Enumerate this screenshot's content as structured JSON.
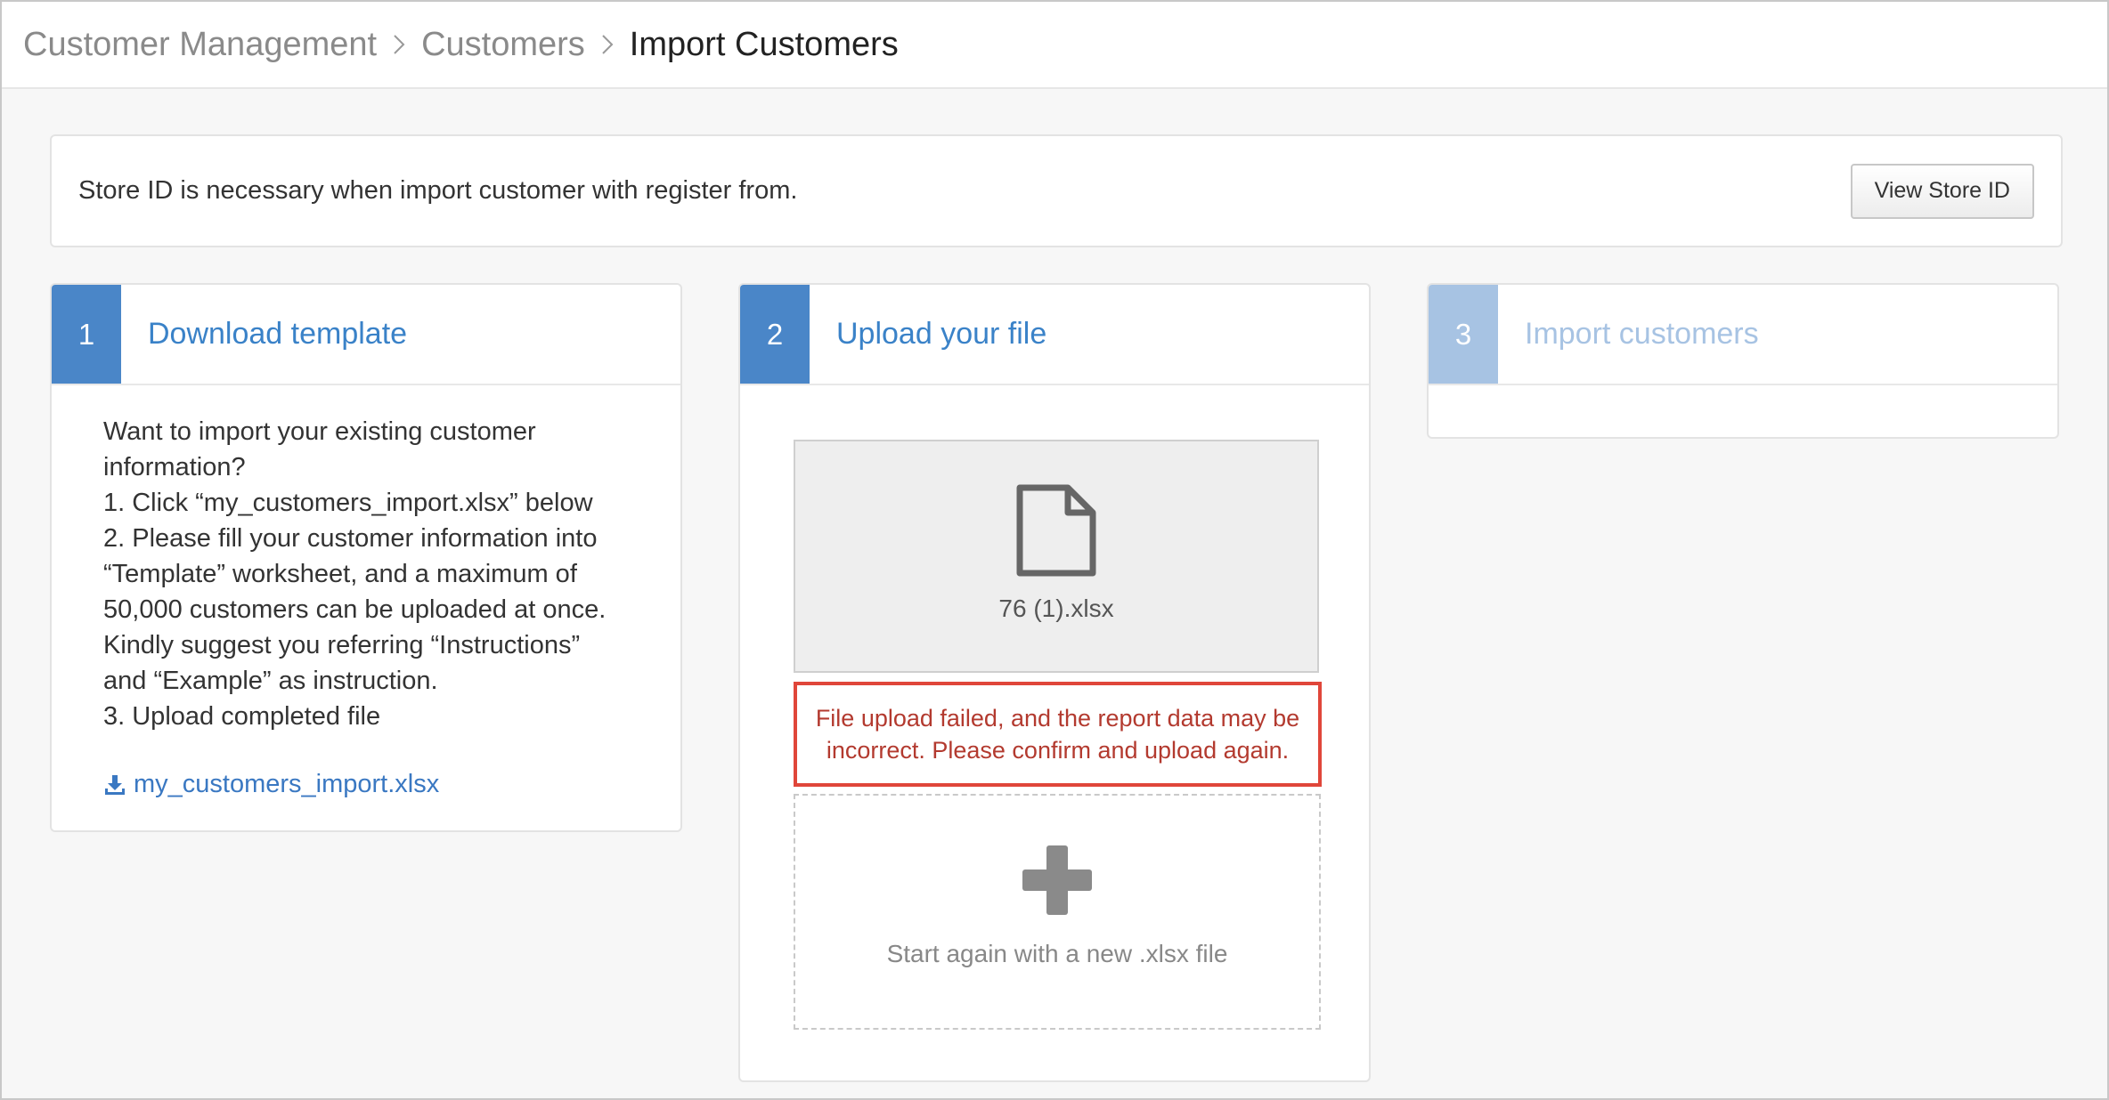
{
  "breadcrumb": {
    "items": [
      "Customer Management",
      "Customers"
    ],
    "current": "Import Customers"
  },
  "notice": {
    "text": "Store ID is necessary when import customer with register from.",
    "button_label": "View Store ID"
  },
  "steps": [
    {
      "number": "1",
      "title": "Download template",
      "instructions": [
        "Want to import your existing customer",
        "information?",
        "1. Click “my_customers_import.xlsx” below",
        "2. Please fill your customer information into",
        "“Template” worksheet, and a maximum of",
        "50,000 customers can be uploaded at once.",
        "Kindly suggest you referring “Instructions”",
        "and “Example” as instruction.",
        "3. Upload completed file"
      ],
      "download_link": "my_customers_import.xlsx"
    },
    {
      "number": "2",
      "title": "Upload your file",
      "file_name": "76 (1).xlsx",
      "error": "File upload failed, and the report data may be incorrect. Please confirm and upload again.",
      "drop_text": "Start again with a new .xlsx file"
    },
    {
      "number": "3",
      "title": "Import customers"
    }
  ],
  "colors": {
    "accent": "#4a86c8",
    "accent_disabled": "#a7c3e3",
    "link": "#3a78c2",
    "error_border": "#e0463a",
    "error_text": "#b33a2f"
  },
  "icons": {
    "breadcrumb_separator": "chevron-right-icon",
    "download": "download-icon",
    "file": "file-icon",
    "add": "plus-icon"
  }
}
